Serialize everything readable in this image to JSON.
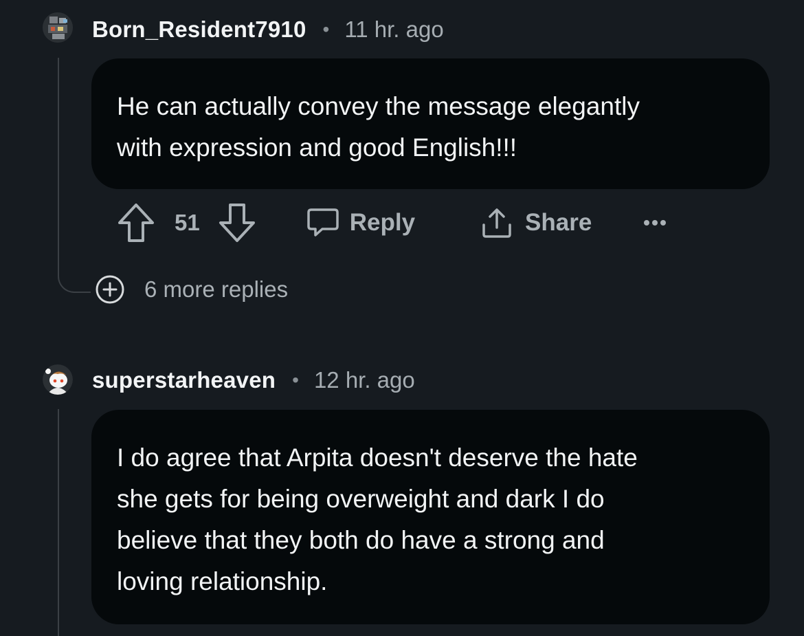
{
  "comments": [
    {
      "username": "Born_Resident7910",
      "separator": "•",
      "timestamp": "11 hr. ago",
      "body_lines": [
        "He can actually convey the message elegantly",
        "with expression and good English!!!"
      ],
      "actions": {
        "upvote_icon": "upvote-arrow-icon",
        "score": "51",
        "downvote_icon": "downvote-arrow-icon",
        "reply_label": "Reply",
        "share_label": "Share",
        "more_icon": "ellipsis-icon"
      },
      "more_replies_label": "6 more replies"
    },
    {
      "username": "superstarheaven",
      "separator": "•",
      "timestamp": "12 hr. ago",
      "body_lines": [
        "I do agree that Arpita doesn't deserve the hate",
        "she gets for being overweight and dark I do",
        "believe that they both do have a strong and",
        "loving relationship."
      ]
    }
  ],
  "colors": {
    "background": "#161b20",
    "bubble": "#05090b",
    "text": "#f2f4f5",
    "muted": "#aab1b6",
    "thread_line": "#3b4045"
  }
}
